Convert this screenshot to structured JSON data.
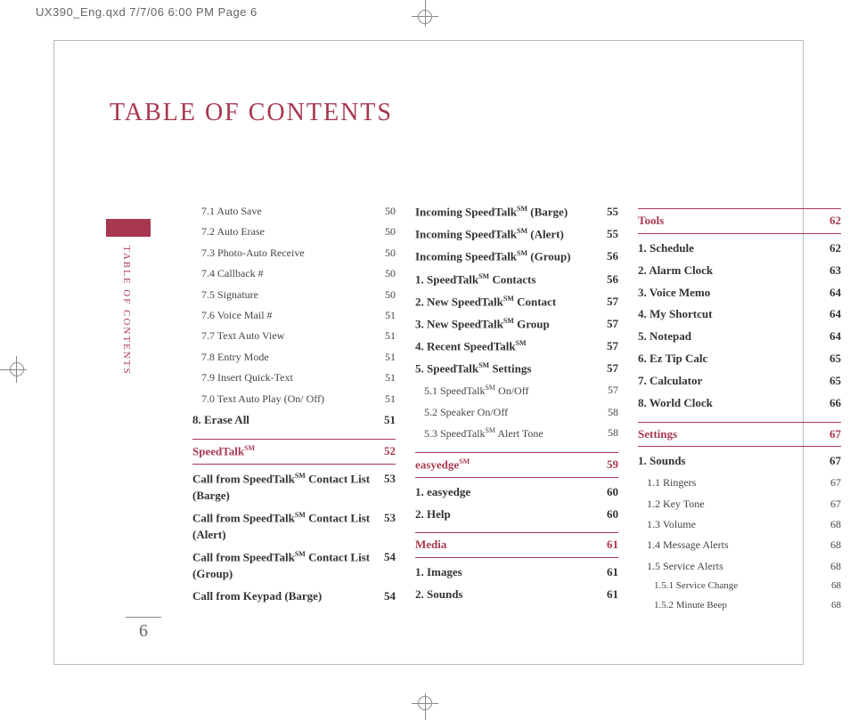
{
  "crop_header": "UX390_Eng.qxd  7/7/06  6:00 PM  Page 6",
  "title": "TABLE OF CONTENTS",
  "side_label": "TABLE OF CONTENTS",
  "page_number": "6",
  "col1": {
    "items_top": [
      {
        "label": "7.1 Auto Save",
        "page": "50"
      },
      {
        "label": "7.2 Auto Erase",
        "page": "50"
      },
      {
        "label": "7.3 Photo-Auto Receive",
        "page": "50"
      },
      {
        "label": "7.4 Callback #",
        "page": "50"
      },
      {
        "label": "7.5 Signature",
        "page": "50"
      },
      {
        "label": "7.6 Voice Mail #",
        "page": "51"
      },
      {
        "label": "7.7 Text Auto View",
        "page": "51"
      },
      {
        "label": "7.8 Entry Mode",
        "page": "51"
      },
      {
        "label": "7.9 Insert Quick-Text",
        "page": "51"
      },
      {
        "label": "7.0 Text Auto Play (On/ Off)",
        "page": "51"
      }
    ],
    "erase_all": {
      "label": "8. Erase All",
      "page": "51"
    },
    "speedtalk_head": {
      "label": "SpeedTalk",
      "sm": "SM",
      "page": "52"
    },
    "items_bottom": [
      {
        "label_prefix": "Call from SpeedTalk",
        "sm": "SM",
        "label_suffix": " Contact List (Barge)",
        "page": "53"
      },
      {
        "label_prefix": "Call from SpeedTalk",
        "sm": "SM",
        "label_suffix": " Contact List (Alert)",
        "page": "53"
      },
      {
        "label_prefix": "Call from SpeedTalk",
        "sm": "SM",
        "label_suffix": " Contact List (Group)",
        "page": "54"
      },
      {
        "label_prefix": "Call from Keypad (Barge)",
        "sm": "",
        "label_suffix": "",
        "page": "54"
      }
    ]
  },
  "col2": {
    "top": [
      {
        "prefix": "Incoming SpeedTalk",
        "sm": "SM",
        "suffix": " (Barge)",
        "page": "55"
      },
      {
        "prefix": "Incoming SpeedTalk",
        "sm": "SM",
        "suffix": " (Alert)",
        "page": "55"
      },
      {
        "prefix": "Incoming SpeedTalk",
        "sm": "SM",
        "suffix": " (Group)",
        "page": "56"
      },
      {
        "prefix": "1. SpeedTalk",
        "sm": "SM",
        "suffix": " Contacts",
        "page": "56"
      },
      {
        "prefix": "2. New SpeedTalk",
        "sm": "SM",
        "suffix": " Contact",
        "page": "57"
      },
      {
        "prefix": "3. New SpeedTalk",
        "sm": "SM",
        "suffix": " Group",
        "page": "57"
      },
      {
        "prefix": "4. Recent SpeedTalk",
        "sm": "SM",
        "suffix": "",
        "page": "57"
      },
      {
        "prefix": "5. SpeedTalk",
        "sm": "SM",
        "suffix": " Settings",
        "page": "57"
      }
    ],
    "subs": [
      {
        "prefix": "5.1 SpeedTalk",
        "sm": "SM",
        "suffix": " On/Off",
        "page": "57"
      },
      {
        "prefix": "5.2 Speaker On/Off",
        "sm": "",
        "suffix": "",
        "page": "58"
      },
      {
        "prefix": "5.3 SpeedTalk",
        "sm": "SM",
        "suffix": " Alert Tone",
        "page": "58"
      }
    ],
    "easyedge_head": {
      "red": "easy",
      "rest": "edge",
      "sm": "SM",
      "page": "59"
    },
    "easyedge_items": [
      {
        "red": "1. easy",
        "rest": "edge",
        "page": "60"
      },
      {
        "red": "",
        "rest": "2. Help",
        "page": "60"
      }
    ],
    "media_head": {
      "label": "Media",
      "page": "61"
    },
    "media_items": [
      {
        "label": "1. Images",
        "page": "61"
      },
      {
        "label": "2. Sounds",
        "page": "61"
      }
    ]
  },
  "col3": {
    "tools_head": {
      "label": "Tools",
      "page": "62"
    },
    "tools_items": [
      {
        "label": "1. Schedule",
        "page": "62"
      },
      {
        "label": "2. Alarm Clock",
        "page": "63"
      },
      {
        "label": "3. Voice Memo",
        "page": "64"
      },
      {
        "label": "4. My Shortcut",
        "page": "64"
      },
      {
        "label": "5. Notepad",
        "page": "64"
      },
      {
        "label": "6. Ez Tip Calc",
        "page": "65"
      },
      {
        "label": "7. Calculator",
        "page": "65"
      },
      {
        "label": "8. World Clock",
        "page": "66"
      }
    ],
    "settings_head": {
      "label": "Settings",
      "page": "67"
    },
    "sounds": {
      "label": "1. Sounds",
      "page": "67"
    },
    "sounds_subs": [
      {
        "label": "1.1 Ringers",
        "page": "67"
      },
      {
        "label": "1.2 Key Tone",
        "page": "67"
      },
      {
        "label": "1.3 Volume",
        "page": "68"
      },
      {
        "label": "1.4 Message Alerts",
        "page": "68"
      },
      {
        "label": "1.5 Service Alerts",
        "page": "68"
      }
    ],
    "sounds_subsubs": [
      {
        "label": "1.5.1 Service Change",
        "page": "68"
      },
      {
        "label": "1.5.2 Minute Beep",
        "page": "68"
      }
    ]
  }
}
